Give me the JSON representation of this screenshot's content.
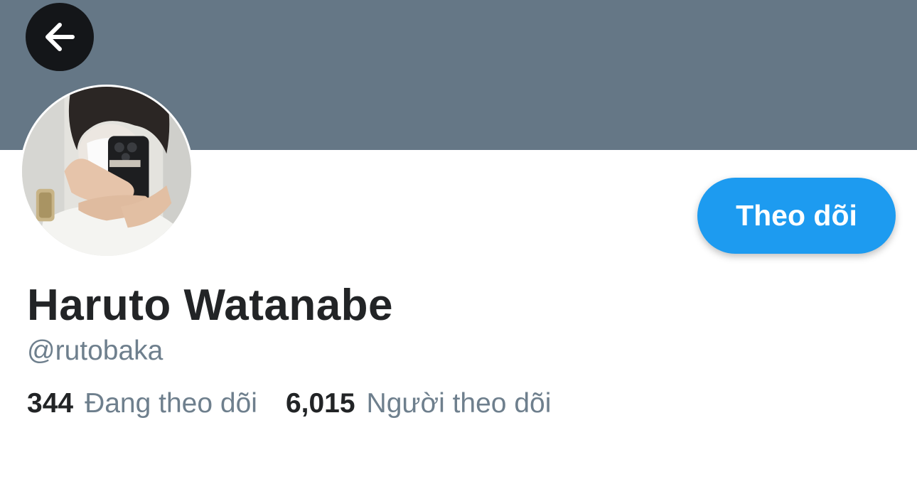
{
  "header": {
    "back_icon": "arrow-left-icon",
    "banner_color": "#657786"
  },
  "profile": {
    "display_name": "Haruto Watanabe",
    "handle": "@rutobaka",
    "follow_button_label": "Theo dõi",
    "follow_button_color": "#1d9bf0",
    "stats": {
      "following": {
        "count": "344",
        "label": "Đang theo dõi"
      },
      "followers": {
        "count": "6,015",
        "label": "Người theo dõi"
      }
    }
  }
}
